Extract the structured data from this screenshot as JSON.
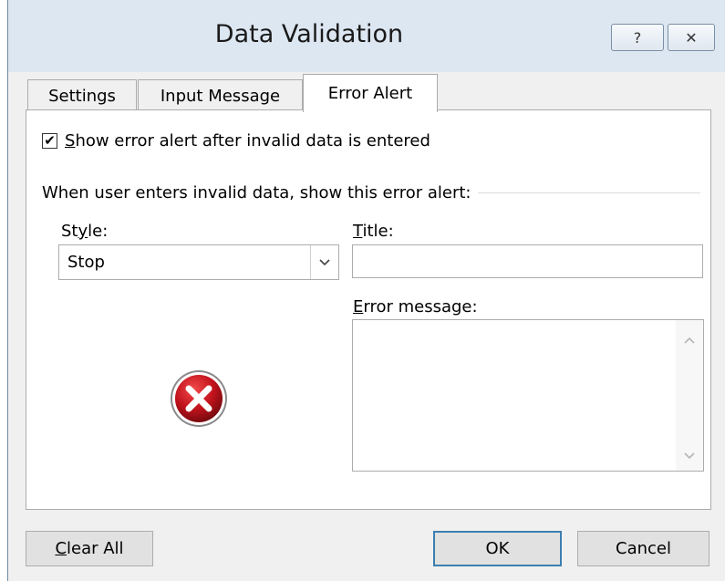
{
  "window": {
    "title": "Data Validation",
    "help_label": "?",
    "close_label": "✕"
  },
  "tabs": [
    {
      "label": "Settings",
      "active": false
    },
    {
      "label": "Input Message",
      "active": false
    },
    {
      "label": "Error Alert",
      "active": true
    }
  ],
  "show_alert": {
    "checked": true,
    "check_mark": "✔",
    "label_mnemonic": "S",
    "label_rest": "how error alert after invalid data is entered"
  },
  "group_label": "When user enters invalid data, show this error alert:",
  "style": {
    "label_pre": "St",
    "label_mnemonic": "y",
    "label_post": "le:",
    "value": "Stop",
    "dropdown_arrow": "⌄"
  },
  "title_field": {
    "label_mnemonic": "T",
    "label_rest": "itle:",
    "value": ""
  },
  "error_message": {
    "label_mnemonic": "E",
    "label_rest": "rror message:",
    "value": "",
    "scroll_up": "︿",
    "scroll_down": "﹀"
  },
  "icon": {
    "name": "stop-error-icon",
    "color": "#c0121b"
  },
  "buttons": {
    "clear_mnemonic": "C",
    "clear_rest": "lear All",
    "ok": "OK",
    "cancel": "Cancel"
  }
}
